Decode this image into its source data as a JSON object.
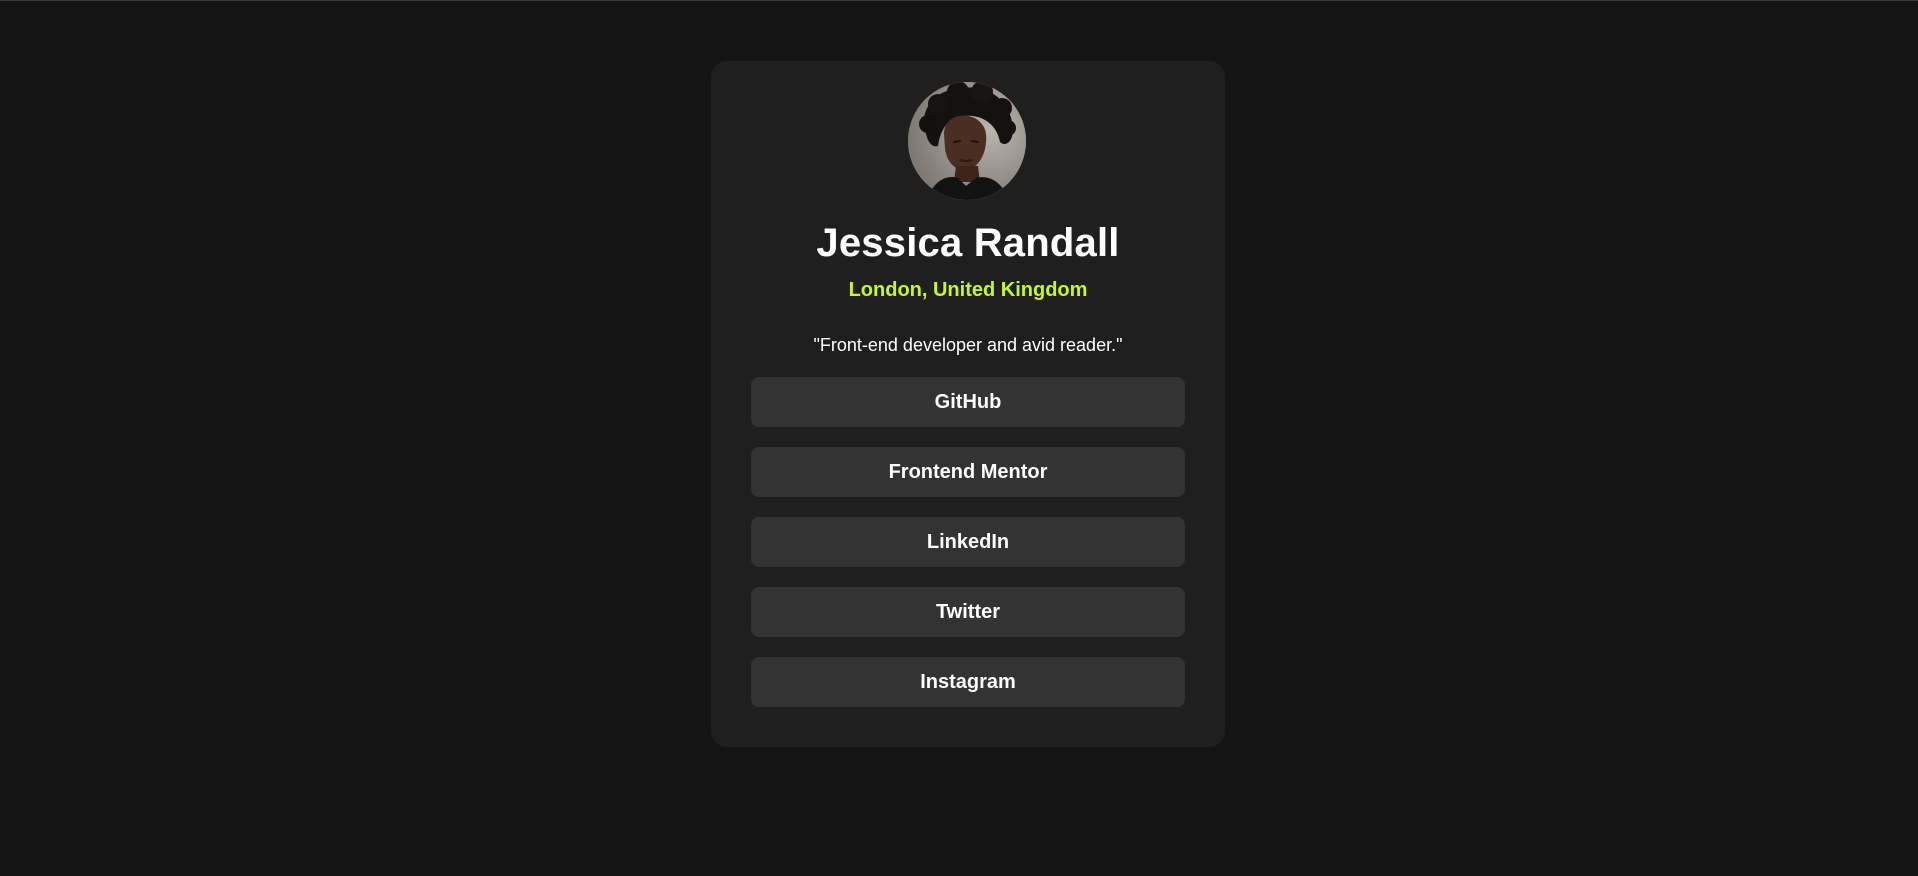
{
  "profile": {
    "name": "Jessica Randall",
    "location": "London, United Kingdom",
    "bio": "\"Front-end developer and avid reader.\""
  },
  "links": [
    {
      "label": "GitHub"
    },
    {
      "label": "Frontend Mentor"
    },
    {
      "label": "LinkedIn"
    },
    {
      "label": "Twitter"
    },
    {
      "label": "Instagram"
    }
  ],
  "colors": {
    "background": "#141414",
    "card": "#1f1f1f",
    "button": "#333333",
    "accent": "#c5f82a",
    "text": "#ffffff"
  }
}
